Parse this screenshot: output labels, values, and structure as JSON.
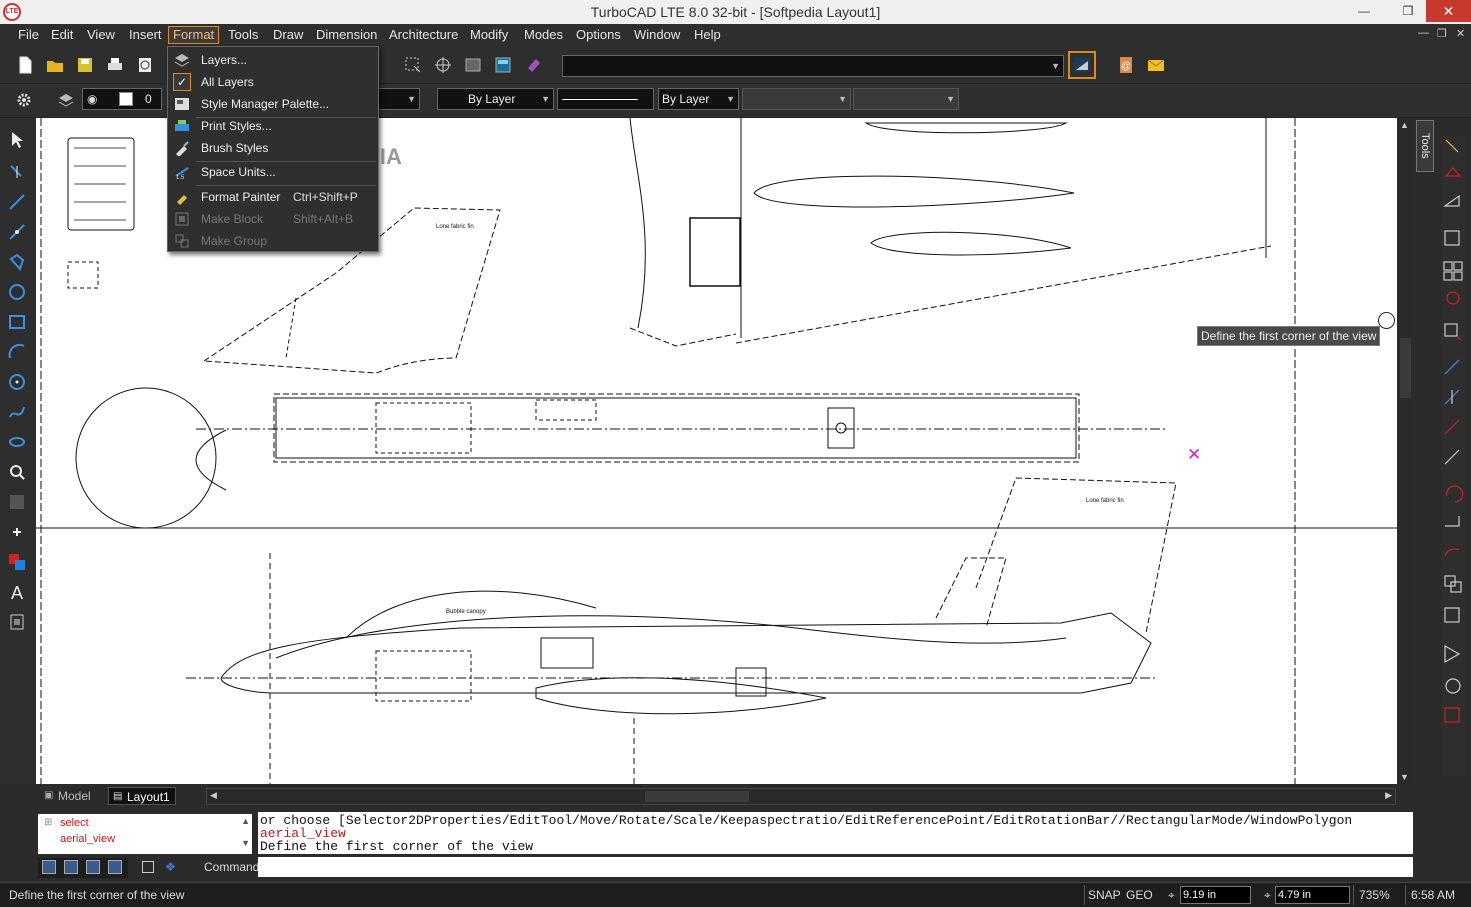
{
  "window": {
    "title": "TurboCAD LTE 8.0 32-bit - [Softpedia Layout1]",
    "app_icon_label": "LTE",
    "controls": [
      "—",
      "❐",
      "✕"
    ]
  },
  "menu": {
    "items": [
      "File",
      "Edit",
      "View",
      "Insert",
      "Format",
      "Tools",
      "Draw",
      "Dimension",
      "Architecture",
      "Modify",
      "Modes",
      "Options",
      "Window",
      "Help"
    ],
    "active": "Format",
    "doc_controls": [
      "—",
      "❐",
      "✕"
    ]
  },
  "format_menu": {
    "items": [
      {
        "label": "Layers...",
        "shortcut": "",
        "disabled": false
      },
      {
        "label": "All Layers",
        "shortcut": "",
        "disabled": false,
        "checked": true
      },
      {
        "label": "Style Manager Palette...",
        "shortcut": "",
        "disabled": false
      },
      {
        "label": "Print Styles...",
        "shortcut": "",
        "disabled": false
      },
      {
        "label": "Brush Styles",
        "shortcut": "",
        "disabled": false
      },
      {
        "label": "Space Units...",
        "shortcut": "",
        "disabled": false
      },
      {
        "label": "Format Painter",
        "shortcut": "Ctrl+Shift+P",
        "disabled": false
      },
      {
        "label": "Make Block",
        "shortcut": "Shift+Alt+B",
        "disabled": true
      },
      {
        "label": "Make Group",
        "shortcut": "",
        "disabled": true
      }
    ]
  },
  "property_bar": {
    "layer_value": "0",
    "color_value": "By Layer",
    "linestyle_value": "By Layer"
  },
  "tabs": [
    {
      "label": "Model",
      "active": false
    },
    {
      "label": "Layout1",
      "active": true
    }
  ],
  "tree": {
    "items": [
      "select",
      "aerial_view"
    ]
  },
  "command_history": {
    "line1": "   or choose [Selector2DProperties/EditTool/Move/Rotate/Scale/Keepaspectratio/EditReferencePoint/EditRotationBar//RectangularMode/WindowPolygon",
    "line2": "aerial_view",
    "line3": "Define the first corner of the view"
  },
  "command_label": "Command:",
  "tooltip": "Define the first corner of the view",
  "right_palette_label": "Tools",
  "status": {
    "message": "Define the first corner of the view",
    "snap": "SNAP",
    "geo": "GEO",
    "x": "9.19 in",
    "y": "4.79 in",
    "zoom": "735%",
    "time": "6:58 AM"
  },
  "drawing_labels": {
    "watermark": "SOFTPEDIA"
  },
  "colors": {
    "accent": "#e08a1e",
    "background": "#2b2b2b",
    "canvas": "#ffffff",
    "cursor_mark": "#d020d0"
  }
}
